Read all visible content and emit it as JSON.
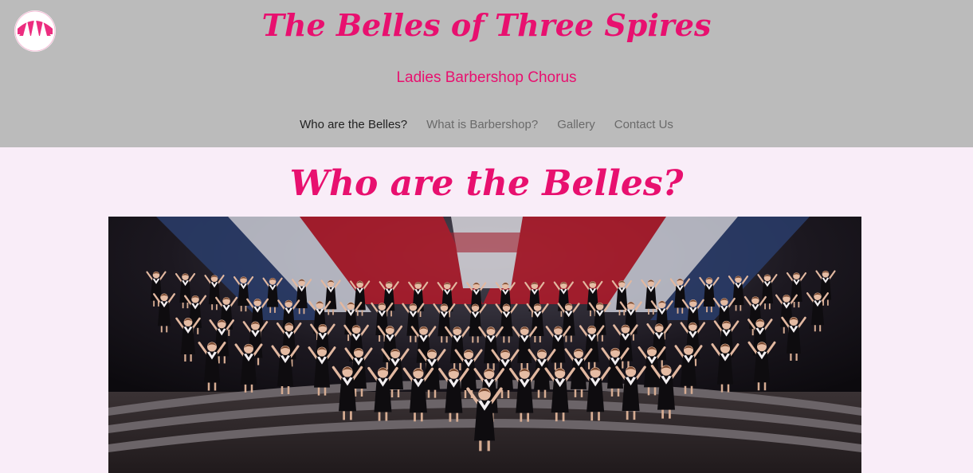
{
  "header": {
    "site_title": "The Belles of Three Spires",
    "subtitle": "Ladies Barbershop Chorus",
    "logo_icon": "three-spires-logo-icon"
  },
  "nav": {
    "items": [
      {
        "label": "Who are the Belles?",
        "active": true
      },
      {
        "label": "What is Barbershop?",
        "active": false
      },
      {
        "label": "Gallery",
        "active": false
      },
      {
        "label": "Contact Us",
        "active": false
      }
    ]
  },
  "main": {
    "heading": "Who are the Belles?",
    "photo_icon": "chorus-photo"
  },
  "colors": {
    "header_bg": "#bbbbbb",
    "page_bg": "#f9edf8",
    "accent": "#e8106f",
    "nav_text": "#6a6a6a",
    "nav_active": "#222222"
  }
}
